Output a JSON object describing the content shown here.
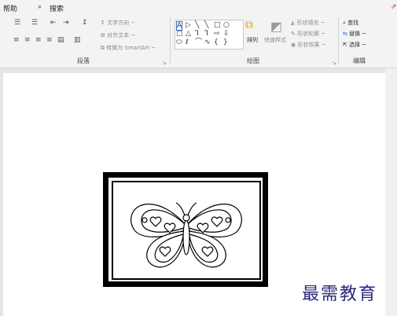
{
  "menu": {
    "help": "帮助",
    "search": "搜索"
  },
  "paragraph": {
    "text_direction": "文字方向 ~",
    "align_text": "对齐文本 ~",
    "convert_smartart": "转换为 SmartArt ~",
    "label": "段落"
  },
  "drawing": {
    "arrange": "排列",
    "quick_styles": "快速样式",
    "shape_fill": "形状填充 ~",
    "shape_outline": "形状轮廓 ~",
    "shape_effects": "形状效果 ~",
    "label": "绘图"
  },
  "editing": {
    "find": "查找",
    "replace": "替换 ~",
    "select": "选择 ~",
    "label": "编辑"
  },
  "watermark": "最需教育",
  "colors": {
    "accent": "#c43e1c",
    "ribbon": "#f3f3f3",
    "page": "#ffffff"
  }
}
